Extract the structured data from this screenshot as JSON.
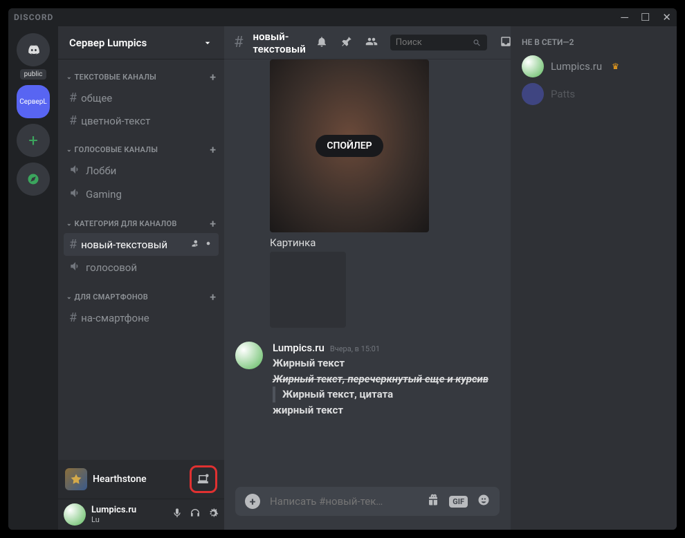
{
  "app_title": "DISCORD",
  "server_name": "Сервер Lumpics",
  "public_badge": "public",
  "active_server_label": "СерверL",
  "categories": [
    {
      "name": "ТЕКСТОВЫЕ КАНАЛЫ",
      "channels": [
        {
          "type": "text",
          "name": "общее",
          "active": false
        },
        {
          "type": "text",
          "name": "цветной-текст",
          "active": false
        }
      ]
    },
    {
      "name": "ГОЛОСОВЫЕ КАНАЛЫ",
      "channels": [
        {
          "type": "voice",
          "name": "Лобби",
          "active": false
        },
        {
          "type": "voice",
          "name": "Gaming",
          "active": false
        }
      ]
    },
    {
      "name": "КАТЕГОРИЯ ДЛЯ КАНАЛОВ",
      "channels": [
        {
          "type": "text",
          "name": "новый-текстовый",
          "active": true
        },
        {
          "type": "voice",
          "name": "голосовой",
          "active": false
        }
      ]
    },
    {
      "name": "ДЛЯ СМАРТФОНОВ",
      "channels": [
        {
          "type": "text",
          "name": "на-смартфоне",
          "active": false
        }
      ]
    }
  ],
  "activity": {
    "name": "Hearthstone"
  },
  "user": {
    "name": "Lumpics.ru",
    "tag": "Lu"
  },
  "current_channel": "новый-текстовый",
  "search_placeholder": "Поиск",
  "spoiler_label": "СПОЙЛЕР",
  "image_caption": "Картинка",
  "message": {
    "author": "Lumpics.ru",
    "time": "Вчера, в 15:01",
    "line1": "Жирный текст",
    "line2": "Жирный текст, перечеркнутый еще и курсив",
    "line3": "Жирный текст, цитата",
    "line4": "жирный текст"
  },
  "input_placeholder": "Написать #новый-тек…",
  "members_header": "НЕ В СЕТИ—2",
  "members": [
    {
      "name": "Lumpics.ru",
      "dimmed": false,
      "crown": true,
      "avatar": "yoshi"
    },
    {
      "name": "Patts",
      "dimmed": true,
      "crown": false,
      "avatar": "discord"
    }
  ],
  "gif_label": "GIF"
}
